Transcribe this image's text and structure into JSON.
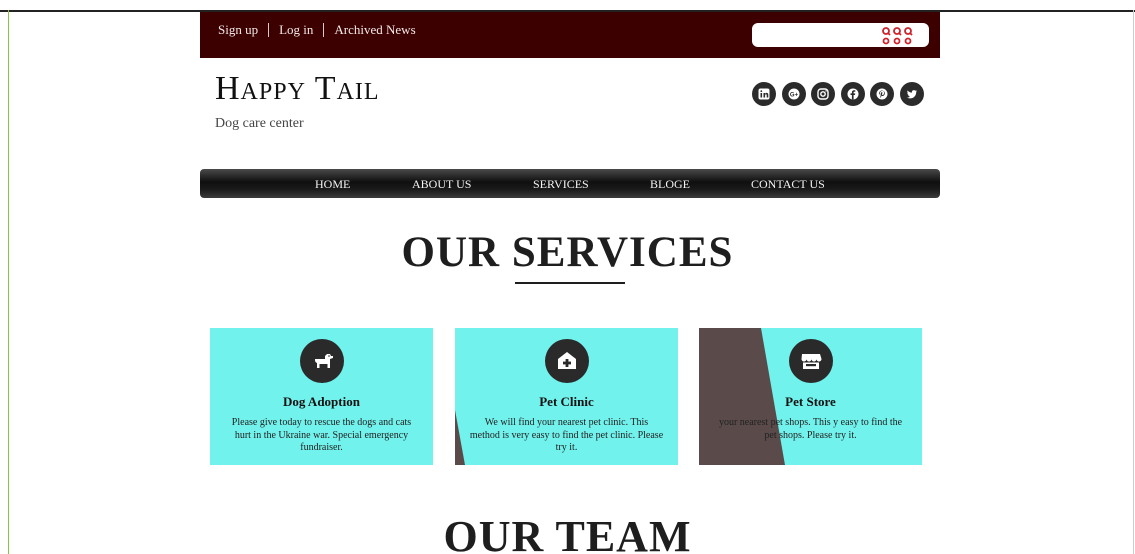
{
  "topbar": {
    "links": [
      "Sign up",
      "Log in",
      "Archived News"
    ],
    "search_placeholder": ""
  },
  "brand": {
    "title": "Happy Tail",
    "tagline": "Dog care center"
  },
  "social": [
    "linkedin-icon",
    "google-plus-icon",
    "instagram-icon",
    "facebook-icon",
    "pinterest-icon",
    "twitter-icon"
  ],
  "nav": [
    "HOME",
    "ABOUT US",
    "SERVICES",
    "BLOGE",
    "CONTACT US"
  ],
  "sections": {
    "services_title": "OUR SERVICES",
    "team_title": "OUR TEAM"
  },
  "services": [
    {
      "title": "Dog Adoption",
      "text": "Please give today to rescue the dogs and cats hurt in the Ukraine war. Special emergency fundraiser.",
      "icon": "dog-icon"
    },
    {
      "title": "Pet Clinic",
      "text": "We will find your nearest pet clinic. This method is very easy to find the pet clinic. Please try it.",
      "icon": "clinic-icon"
    },
    {
      "title": "Pet Store",
      "text": "your nearest pet shops. This y easy to find the pet shops. Please try it.",
      "icon": "store-icon"
    }
  ],
  "colors": {
    "topbar": "#3d0000",
    "card": "#72f2ec",
    "wedge": "#5a4a4a"
  }
}
